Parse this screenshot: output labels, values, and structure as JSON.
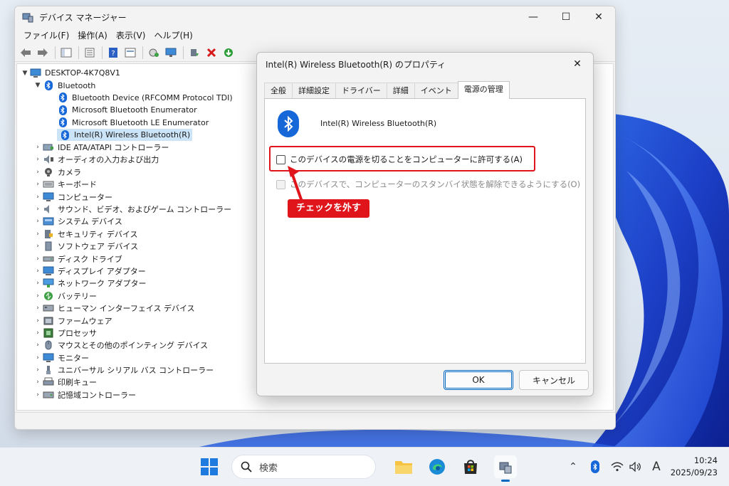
{
  "device_manager": {
    "title": "デバイス マネージャー",
    "menu": [
      "ファイル(F)",
      "操作(A)",
      "表示(V)",
      "ヘルプ(H)"
    ],
    "root": "DESKTOP-4K7Q8V1",
    "bluetooth": {
      "label": "Bluetooth",
      "children": [
        "Bluetooth Device (RFCOMM Protocol TDI)",
        "Microsoft Bluetooth Enumerator",
        "Microsoft Bluetooth LE Enumerator",
        "Intel(R) Wireless Bluetooth(R)"
      ]
    },
    "categories": [
      "IDE ATA/ATAPI コントローラー",
      "オーディオの入力および出力",
      "カメラ",
      "キーボード",
      "コンピューター",
      "サウンド、ビデオ、およびゲーム コントローラー",
      "システム デバイス",
      "セキュリティ デバイス",
      "ソフトウェア デバイス",
      "ディスク ドライブ",
      "ディスプレイ アダプター",
      "ネットワーク アダプター",
      "バッテリー",
      "ヒューマン インターフェイス デバイス",
      "ファームウェア",
      "プロセッサ",
      "マウスとその他のポインティング デバイス",
      "モニター",
      "ユニバーサル シリアル バス コントローラー",
      "印刷キュー",
      "記憶域コントローラー"
    ]
  },
  "dialog": {
    "title": "Intel(R) Wireless Bluetooth(R) のプロパティ",
    "tabs": [
      "全般",
      "詳細設定",
      "ドライバー",
      "詳細",
      "イベント",
      "電源の管理"
    ],
    "device_name": "Intel(R) Wireless Bluetooth(R)",
    "option1": "このデバイスの電源を切ることをコンピューターに許可する(A)",
    "option2": "このデバイスで、コンピューターのスタンバイ状態を解除できるようにする(O)",
    "callout": "チェックを外す",
    "ok": "OK",
    "cancel": "キャンセル"
  },
  "taskbar": {
    "search_placeholder": "検索",
    "ime": "A",
    "time": "10:24",
    "date": "2025/09/23"
  },
  "colors": {
    "accent": "#0067c0",
    "bluetooth": "#1668d9",
    "highlight": "#e0141b",
    "selection": "#cce4f7"
  }
}
